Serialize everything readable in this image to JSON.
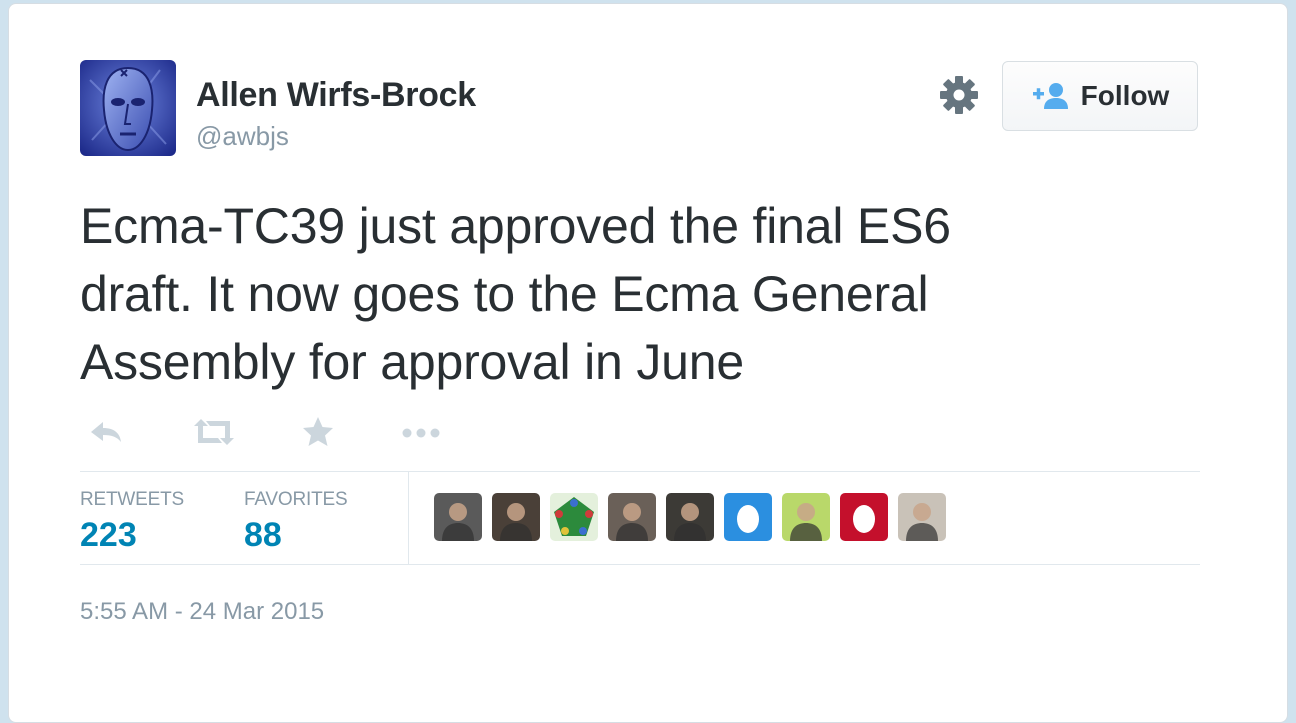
{
  "author": {
    "name": "Allen Wirfs-Brock",
    "handle": "@awbjs",
    "avatar_icon": "face-avatar"
  },
  "header": {
    "settings_icon": "gear-icon",
    "follow_icon": "add-user-icon",
    "follow_label": "Follow"
  },
  "tweet": {
    "line1": "Ecma-TC39 just approved the final ES6",
    "line2": "draft. It now goes to the Ecma General",
    "line3": "Assembly for approval in June"
  },
  "actions": [
    {
      "name": "reply",
      "icon": "reply-icon"
    },
    {
      "name": "retweet",
      "icon": "retweet-icon"
    },
    {
      "name": "favorite",
      "icon": "star-icon"
    },
    {
      "name": "more",
      "icon": "ellipsis-icon"
    }
  ],
  "stats": {
    "retweets_label": "RETWEETS",
    "retweets_value": "223",
    "favorites_label": "FAVORITES",
    "favorites_value": "88"
  },
  "favoriters": [
    {
      "kind": "photo",
      "color": "#5a5a5a"
    },
    {
      "kind": "photo",
      "color": "#4a4038"
    },
    {
      "kind": "pentagon",
      "color": "#2c8a3c"
    },
    {
      "kind": "photo",
      "color": "#6a6058"
    },
    {
      "kind": "photo",
      "color": "#3c3a36"
    },
    {
      "kind": "egg",
      "color": "#2b8fe0"
    },
    {
      "kind": "photo",
      "color": "#b9d86a"
    },
    {
      "kind": "egg",
      "color": "#c4102c"
    },
    {
      "kind": "photo",
      "color": "#c9c2b8"
    }
  ],
  "timestamp": "5:55 AM - 24 Mar 2015",
  "colors": {
    "link": "#0084b4",
    "muted": "#8899a6",
    "text": "#292f33",
    "follow_icon": "#55acee"
  }
}
